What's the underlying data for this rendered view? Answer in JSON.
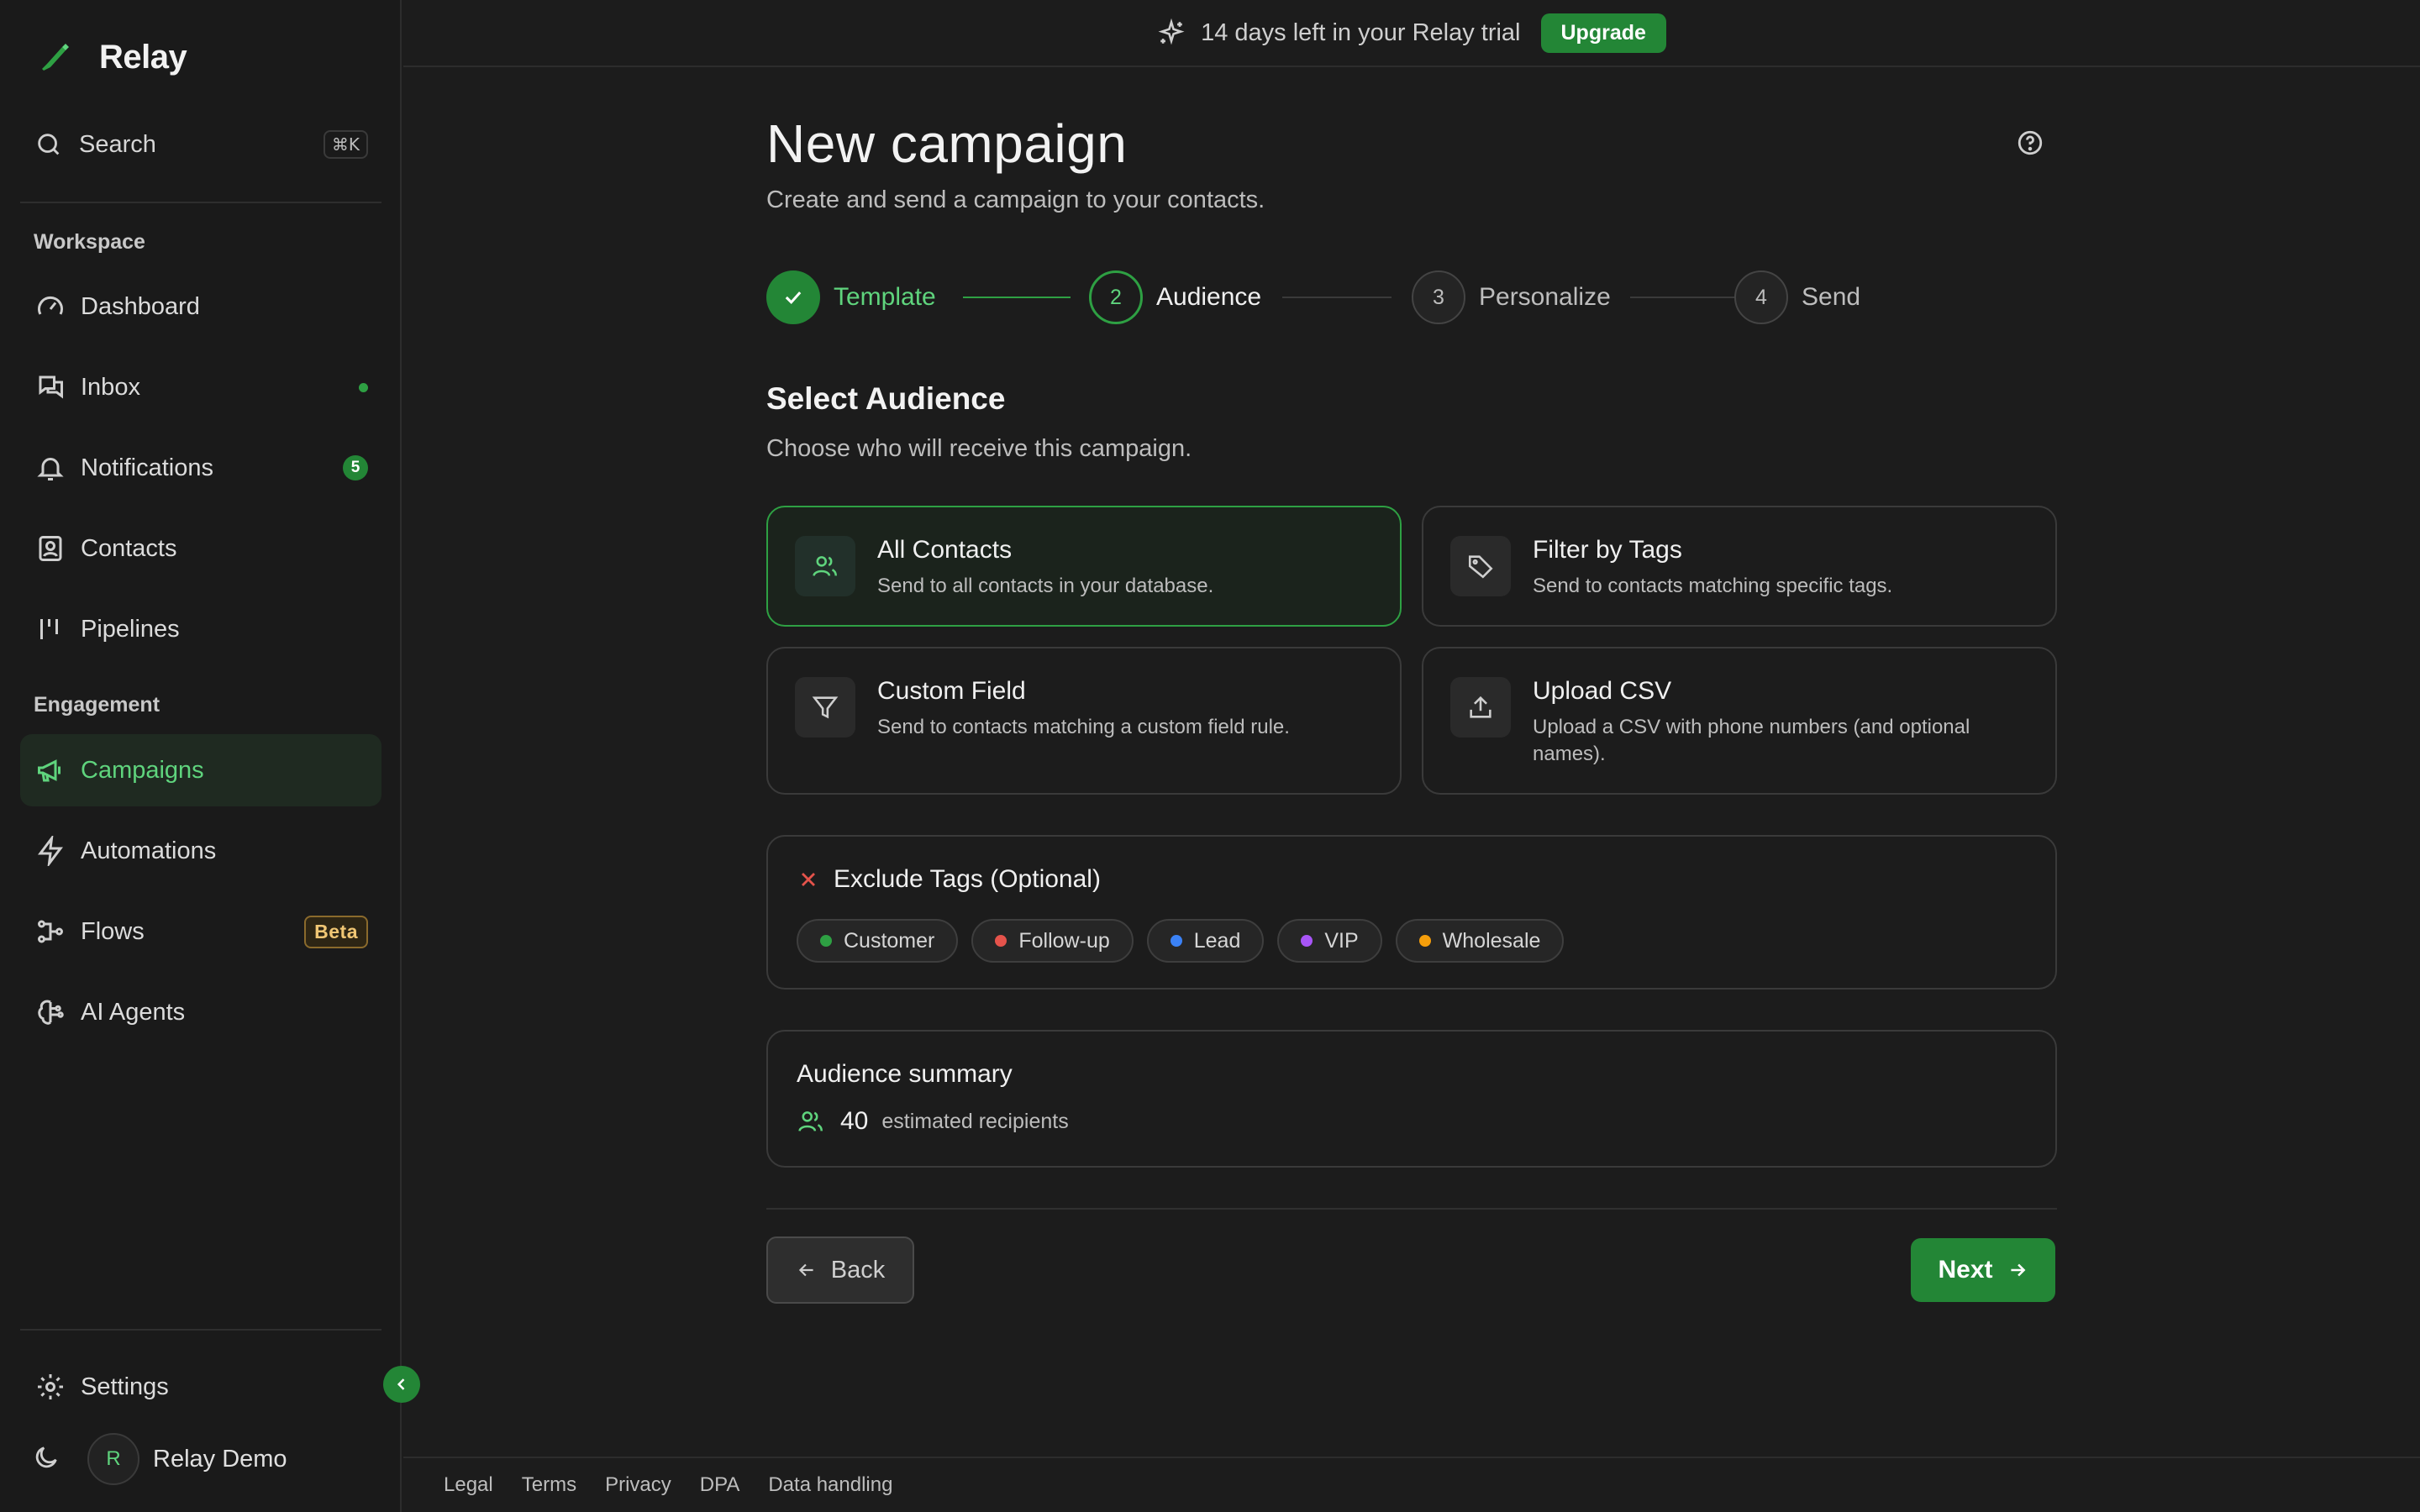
{
  "app": {
    "name": "Relay"
  },
  "sidebar": {
    "search_label": "Search",
    "search_shortcut": "⌘K",
    "workspace_label": "Workspace",
    "engagement_label": "Engagement",
    "workspace_items": [
      {
        "label": "Dashboard",
        "icon": "gauge-icon"
      },
      {
        "label": "Inbox",
        "icon": "chat-icon",
        "indicator": "dot"
      },
      {
        "label": "Notifications",
        "icon": "bell-icon",
        "badge": "5"
      },
      {
        "label": "Contacts",
        "icon": "contacts-icon"
      },
      {
        "label": "Pipelines",
        "icon": "pipeline-icon"
      }
    ],
    "engagement_items": [
      {
        "label": "Campaigns",
        "icon": "megaphone-icon",
        "active": true
      },
      {
        "label": "Automations",
        "icon": "lightning-icon"
      },
      {
        "label": "Flows",
        "icon": "flow-icon",
        "badge": "Beta"
      },
      {
        "label": "AI Agents",
        "icon": "brain-icon"
      }
    ],
    "settings_label": "Settings",
    "user_initial": "R",
    "user_name": "Relay Demo"
  },
  "banner": {
    "text": "14 days left in your Relay trial",
    "button": "Upgrade"
  },
  "main": {
    "title": "New campaign",
    "subtitle": "Create and send a campaign to your contacts.",
    "steps": [
      {
        "number": "",
        "label": "Template",
        "state": "complete"
      },
      {
        "number": "2",
        "label": "Audience",
        "state": "current"
      },
      {
        "number": "3",
        "label": "Personalize",
        "state": "upcoming"
      },
      {
        "number": "4",
        "label": "Send",
        "state": "upcoming"
      }
    ],
    "section_title": "Select Audience",
    "section_subtitle": "Choose who will receive this campaign.",
    "options": [
      {
        "title": "All Contacts",
        "description": "Send to all contacts in your database.",
        "icon": "users-icon",
        "selected": true
      },
      {
        "title": "Filter by Tags",
        "description": "Send to contacts matching specific tags.",
        "icon": "tag-icon",
        "selected": false
      },
      {
        "title": "Custom Field",
        "description": "Send to contacts matching a custom field rule.",
        "icon": "filter-icon",
        "selected": false
      },
      {
        "title": "Upload CSV",
        "description": "Upload a CSV with phone numbers (and optional names).",
        "icon": "upload-icon",
        "selected": false
      }
    ],
    "exclude": {
      "title": "Exclude Tags (Optional)",
      "tags": [
        {
          "label": "Customer",
          "color": "#2ea043"
        },
        {
          "label": "Follow-up",
          "color": "#e5534b"
        },
        {
          "label": "Lead",
          "color": "#3b82f6"
        },
        {
          "label": "VIP",
          "color": "#a855f7"
        },
        {
          "label": "Wholesale",
          "color": "#f59e0b"
        }
      ]
    },
    "summary": {
      "title": "Audience summary",
      "count": "40",
      "label": "estimated recipients"
    },
    "back_label": "Back",
    "next_label": "Next"
  },
  "footer_links": [
    "Legal",
    "Terms",
    "Privacy",
    "DPA",
    "Data handling"
  ],
  "colors": {
    "accent": "#238636",
    "accent_text": "#5fd47d",
    "background": "#1c1c1c"
  }
}
